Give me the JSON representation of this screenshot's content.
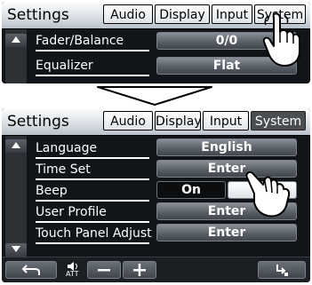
{
  "top_screen": {
    "title": "Settings",
    "tabs": [
      {
        "label": "Audio",
        "active": false
      },
      {
        "label": "Display",
        "active": false
      },
      {
        "label": "Input",
        "active": false
      },
      {
        "label": "System",
        "active": false
      }
    ],
    "rows": [
      {
        "label": "Fader/Balance",
        "value": "0/0"
      },
      {
        "label": "Equalizer",
        "value": "Flat"
      }
    ],
    "tapped_tab": "System"
  },
  "bottom_screen": {
    "title": "Settings",
    "tabs": [
      {
        "label": "Audio",
        "active": false
      },
      {
        "label": "Display",
        "active": false
      },
      {
        "label": "Input",
        "active": false
      },
      {
        "label": "System",
        "active": true
      }
    ],
    "rows": [
      {
        "label": "Language",
        "value": "English"
      },
      {
        "label": "Time Set",
        "value": "Enter"
      },
      {
        "label": "Beep",
        "options": [
          "On",
          "Off"
        ],
        "selected": "On"
      },
      {
        "label": "User Profile",
        "value": "Enter"
      },
      {
        "label": "Touch Panel Adjust",
        "value": "Enter"
      }
    ],
    "bottom_bar": {
      "att_label": "ATT",
      "icons": [
        "back-icon",
        "speaker-att-icon",
        "volume-down-icon",
        "volume-up-icon",
        "return-to-source-icon"
      ]
    }
  },
  "colors": {
    "screen_bg": "#111418",
    "active_tab_bg": "#4a4d52",
    "button_gradient_top": "#8a9098",
    "button_gradient_bottom": "#41464d"
  }
}
